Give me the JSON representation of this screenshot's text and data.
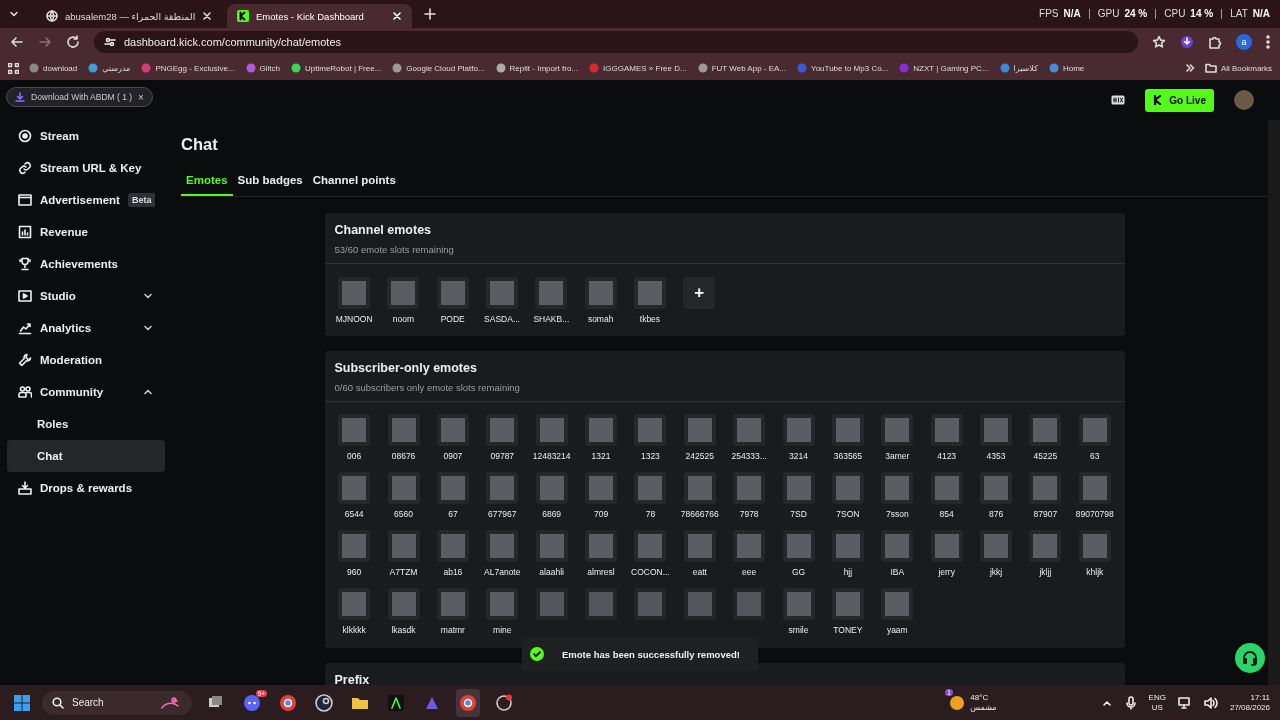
{
  "browser": {
    "tabs": [
      {
        "title": "abusalem28 — المنطقة الحمراء",
        "selected": false
      },
      {
        "title": "Emotes - Kick Dashboard",
        "selected": true
      }
    ],
    "address": "dashboard.kick.com/community/chat/emotes",
    "bookmarks": [
      "download",
      "مدرستي",
      "PNGEgg - Exclusive...",
      "Glitch",
      "UptimeRobot | Free...",
      "Google Cloud Platfo...",
      "Replit - Import fro...",
      "IGGGAMES » Free D...",
      "FUT Web App - EA...",
      "YouTube to Mp3 Co...",
      "NZXT | Gaming PC...",
      "كلاسيرا",
      "Home"
    ],
    "all_bookmarks": "All Bookmarks",
    "profile_initial": "a"
  },
  "overlay": [
    {
      "label": "FPS",
      "value": "N/A"
    },
    {
      "label": "GPU",
      "value": "24 %"
    },
    {
      "label": "CPU",
      "value": "14 %"
    },
    {
      "label": "LAT",
      "value": "N/A"
    }
  ],
  "download_chip": {
    "label": "Download With ABDM ( 1 )",
    "close": "×"
  },
  "topbar": {
    "go_live": "Go Live"
  },
  "sidebar": {
    "items": [
      {
        "label": "Stream",
        "selected": false
      },
      {
        "label": "Stream URL & Key",
        "selected": false
      },
      {
        "label": "Advertisement",
        "badge": "Beta",
        "selected": false
      },
      {
        "label": "Revenue",
        "selected": false
      },
      {
        "label": "Achievements",
        "selected": false
      },
      {
        "label": "Studio",
        "expanded": false,
        "selected": false
      },
      {
        "label": "Analytics",
        "expanded": false,
        "selected": false
      },
      {
        "label": "Moderation",
        "selected": false
      },
      {
        "label": "Community",
        "expanded": true,
        "selected": false,
        "children": [
          {
            "label": "Roles",
            "selected": false
          },
          {
            "label": "Chat",
            "selected": true
          }
        ]
      },
      {
        "label": "Drops & rewards",
        "selected": false
      }
    ]
  },
  "page_title": "Chat",
  "tabs": [
    {
      "label": "Emotes",
      "selected": true
    },
    {
      "label": "Sub badges",
      "selected": false
    },
    {
      "label": "Channel points",
      "selected": false
    }
  ],
  "channel_emotes": {
    "title": "Channel emotes",
    "subtitle": "53/60 emote slots remaining",
    "add": "+",
    "emotes": [
      {
        "name": "MJNOON"
      },
      {
        "name": "noom"
      },
      {
        "name": "PODE"
      },
      {
        "name": "SASDA..."
      },
      {
        "name": "SHAKB..."
      },
      {
        "name": "somah"
      },
      {
        "name": "tkbes"
      }
    ]
  },
  "subscriber_emotes": {
    "title": "Subscriber-only emotes",
    "subtitle": "0/60 subscribers only emote slots remaining",
    "emotes": [
      {
        "name": "006"
      },
      {
        "name": "08676"
      },
      {
        "name": "0907"
      },
      {
        "name": "09787"
      },
      {
        "name": "12483214"
      },
      {
        "name": "1321"
      },
      {
        "name": "1323"
      },
      {
        "name": "242525"
      },
      {
        "name": "254333..."
      },
      {
        "name": "3214"
      },
      {
        "name": "363565"
      },
      {
        "name": "3amer"
      },
      {
        "name": "4123"
      },
      {
        "name": "4353"
      },
      {
        "name": "45225"
      },
      {
        "name": "63"
      },
      {
        "name": "6544"
      },
      {
        "name": "6560"
      },
      {
        "name": "67"
      },
      {
        "name": "677967"
      },
      {
        "name": "6869"
      },
      {
        "name": "709"
      },
      {
        "name": "78"
      },
      {
        "name": "78666766"
      },
      {
        "name": "7978"
      },
      {
        "name": "7SD"
      },
      {
        "name": "7SON"
      },
      {
        "name": "7sson"
      },
      {
        "name": "854"
      },
      {
        "name": "876"
      },
      {
        "name": "87907"
      },
      {
        "name": "89070798"
      },
      {
        "name": "960"
      },
      {
        "name": "A7TZM"
      },
      {
        "name": "ab16"
      },
      {
        "name": "AL7anote"
      },
      {
        "name": "alaahli"
      },
      {
        "name": "almresl"
      },
      {
        "name": "COCON..."
      },
      {
        "name": "eatt"
      },
      {
        "name": "eee"
      },
      {
        "name": "GG"
      },
      {
        "name": "hjj"
      },
      {
        "name": "IBA"
      },
      {
        "name": "jerry"
      },
      {
        "name": "jkkj"
      },
      {
        "name": "jkljj"
      },
      {
        "name": "khljk"
      },
      {
        "name": "klkkkk"
      },
      {
        "name": "lkasdk"
      },
      {
        "name": "matmr"
      },
      {
        "name": "mine"
      },
      {
        "covered": true
      },
      {
        "covered": true
      },
      {
        "covered": true
      },
      {
        "covered": true
      },
      {
        "covered": true
      },
      {
        "name": "smile"
      },
      {
        "name": "TONEY"
      },
      {
        "name": "yaam"
      }
    ]
  },
  "prefix_section": {
    "title": "Prefix"
  },
  "toast": {
    "message": "Emote has been successfully removed!"
  },
  "taskbar": {
    "search": "Search",
    "discord_badge": "9+",
    "weather": {
      "badge": "1",
      "temp": "48°C",
      "desc": "مشمس"
    },
    "lang": "ENG",
    "region": "US",
    "time": "17:11",
    "date": "27/08/2026"
  }
}
